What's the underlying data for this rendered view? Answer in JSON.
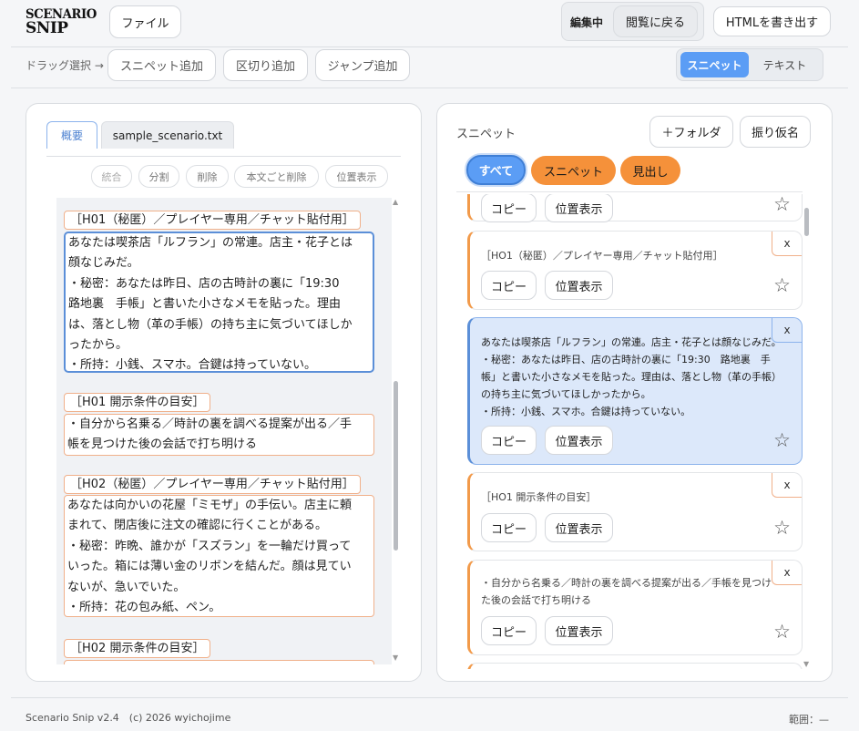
{
  "header": {
    "logo_line1": "SCENARIO",
    "logo_line2": "SNIP",
    "file_label": "ファイル",
    "mode_label": "編集中",
    "back_label": "閲覧に戻る",
    "export_label": "HTMLを書き出す"
  },
  "toolbar": {
    "drag_label": "ドラッグ選択 →",
    "add_snippet": "スニペット追加",
    "add_separator": "区切り追加",
    "add_jump": "ジャンプ追加",
    "toggle_snippet": "スニペット",
    "toggle_text": "テキスト"
  },
  "editor": {
    "tabs": [
      "概要",
      "sample_scenario.txt"
    ],
    "actions": [
      "統合",
      "分割",
      "削除",
      "本文ごと削除",
      "位置表示"
    ],
    "blocks": [
      {
        "heading": "［H01（秘匿）／プレイヤー専用／チャット貼付用］",
        "lines": [
          "あなたは喫茶店「ルフラン」の常連。店主・花子とは",
          "顔なじみだ。",
          "・秘密：あなたは昨日、店の古時計の裏に「19:30　",
          "路地裏　手帳」と書いた小さなメモを貼った。理由",
          "は、落とし物（革の手帳）の持ち主に気づいてほしか",
          "ったから。",
          "・所持：小銭、スマホ。合鍵は持っていない。"
        ]
      },
      {
        "heading": "［H01 開示条件の目安］",
        "lines": [
          "・自分から名乗る／時計の裏を調べる提案が出る／手",
          "帳を見つけた後の会話で打ち明ける"
        ]
      },
      {
        "heading": "［H02（秘匿）／プレイヤー専用／チャット貼付用］",
        "lines": [
          "あなたは向かいの花屋「ミモザ」の手伝い。店主に頼",
          "まれて、閉店後に注文の確認に行くことがある。",
          "・秘密：昨晩、誰かが「スズラン」を一輪だけ買って",
          "いった。箱には薄い金のリボンを結んだ。顔は見てい",
          "ないが、急いでいた。",
          "・所持：花の包み紙、ペン。"
        ]
      },
      {
        "heading": "［H02 開示条件の目安］",
        "lines": []
      }
    ]
  },
  "snippets": {
    "title": "スニペット",
    "folder_label": "＋フォルダ",
    "furigana_label": "振り仮名",
    "filters": [
      "すべて",
      "スニペット",
      "見出し"
    ],
    "copy_label": "コピー",
    "locate_label": "位置表示",
    "close_label": "x",
    "star_label": "☆",
    "cards": [
      {
        "lines": [
          "［HO1（秘匿）／プレイヤー専用／チャット貼付用］"
        ]
      },
      {
        "lines": [
          "あなたは喫茶店「ルフラン」の常連。店主・花子とは顔なじみだ。",
          "・秘密：あなたは昨日、店の古時計の裏に「19:30　路地裏　手",
          "帳」と書いた小さなメモを貼った。理由は、落とし物（革の手帳）",
          "の持ち主に気づいてほしかったから。",
          "・所持：小銭、スマホ。合鍵は持っていない。"
        ]
      },
      {
        "lines": [
          "［HO1 開示条件の目安］"
        ]
      },
      {
        "lines": [
          "・自分から名乗る／時計の裏を調べる提案が出る／手帳を見つけ",
          "た後の会話で打ち明ける"
        ]
      }
    ]
  },
  "footer": {
    "version": "Scenario Snip v2.4　(c) 2026 wyichojime",
    "range": "範囲：—"
  },
  "colors": {
    "accent_blue": "#5b9df5",
    "accent_orange": "#f5913a",
    "card_active_bg": "#dce8fa"
  }
}
